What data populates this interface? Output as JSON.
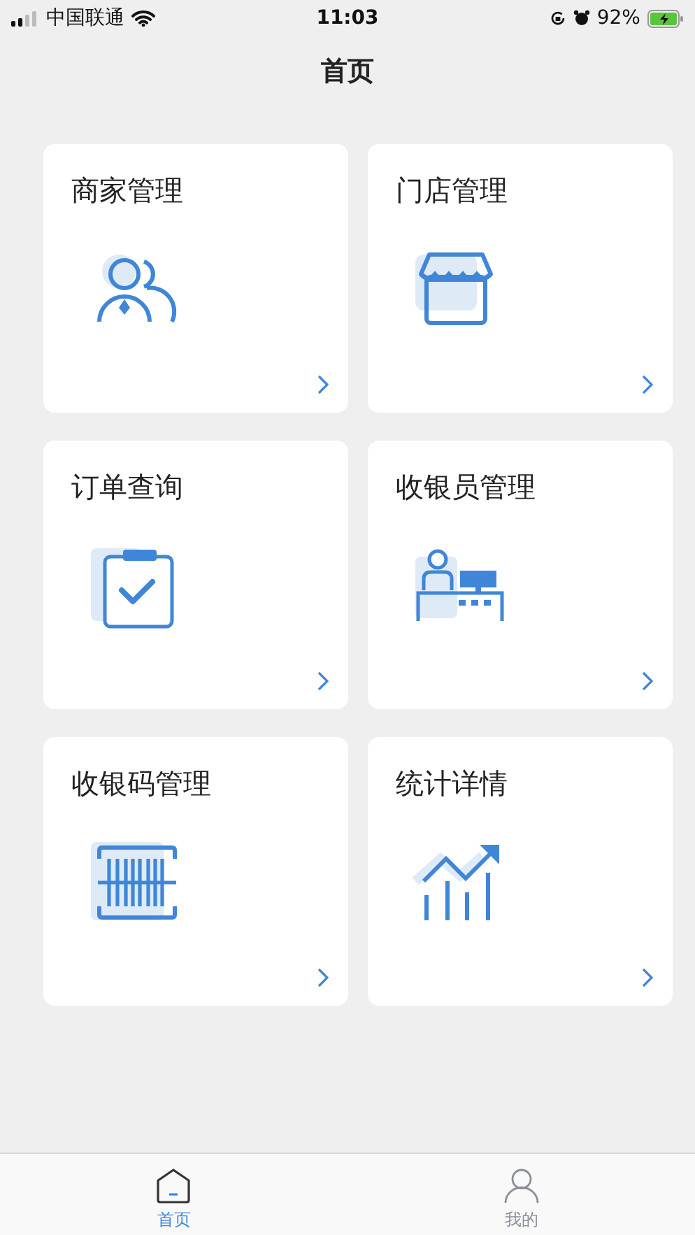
{
  "status_bar": {
    "carrier": "中国联通",
    "time": "11:03",
    "battery": "92%"
  },
  "title": "首页",
  "cards": [
    {
      "label": "商家管理",
      "kind": "merchant"
    },
    {
      "label": "门店管理",
      "kind": "store"
    },
    {
      "label": "订单查询",
      "kind": "order"
    },
    {
      "label": "收银员管理",
      "kind": "cashier"
    },
    {
      "label": "收银码管理",
      "kind": "barcode"
    },
    {
      "label": "统计详情",
      "kind": "stats"
    }
  ],
  "tab_bar": [
    {
      "label": "首页",
      "kind": "home",
      "selected": true
    },
    {
      "label": "我的",
      "kind": "user",
      "selected": false
    }
  ]
}
